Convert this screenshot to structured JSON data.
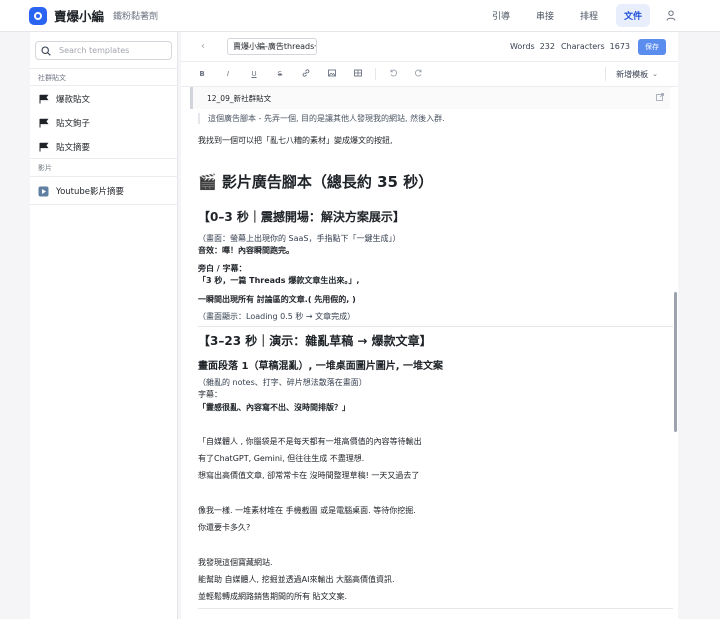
{
  "app": {
    "name": "賣爆小編",
    "subtitle": "鐵粉黏著劑"
  },
  "nav": {
    "items": [
      {
        "label": "引導"
      },
      {
        "label": "串接"
      },
      {
        "label": "排程"
      },
      {
        "label": "文件"
      }
    ],
    "active": "文件",
    "user_icon": "user-icon"
  },
  "sidebar": {
    "search_placeholder": "Search templates",
    "sections": [
      {
        "title": "社群貼文",
        "items": [
          {
            "label": "爆款貼文",
            "icon": "flag-icon"
          },
          {
            "label": "貼文鉤子",
            "icon": "flag-icon"
          },
          {
            "label": "貼文摘要",
            "icon": "flag-icon"
          }
        ]
      },
      {
        "title": "影片",
        "items": [
          {
            "label": "Youtube影片摘要",
            "icon": "play-icon"
          }
        ]
      }
    ]
  },
  "editor": {
    "doc_title": "賣爆小編-廣告threads一",
    "words_label": "Words",
    "words": "232",
    "chars_label": "Characters",
    "chars": "1673",
    "save_label": "保存",
    "toolbar": [
      "B",
      "I",
      "U",
      "S",
      "link",
      "image",
      "table",
      "undo",
      "redo"
    ],
    "template_menu": "新增模板",
    "note_label": "12_09_新社群貼文",
    "content": {
      "quote": "這個廣告腳本 - 先弄一個, 目的是讓其他人發現我的網站, 然後入群.",
      "p1": "我找到一個可以把「亂七八糟的素材」變成爆文的按鈕,",
      "h1": "🎬 影片廣告腳本（總長約 35 秒）",
      "h2_a": "【0–3 秒｜震撼開場：解決方案展示】",
      "a1": "（畫面：螢幕上出現你的 SaaS，手指點下「一鍵生成」）",
      "a2": "音效：嗶！內容瞬間跑完。",
      "a3": "旁白 / 字幕：",
      "a4": "「3 秒，一篇 Threads 爆款文章生出來。」,",
      "a5": "一瞬間出現所有 討論區的文章.( 先用假的, )",
      "a6": "（畫面顯示：Loading 0.5 秒 → 文章完成）",
      "h2_b": "【3–23 秒｜演示：雜亂草稿 → 爆款文章】",
      "h3_b": "畫面段落 1（草稿混亂）, 一堆桌面圖片圖片, 一堆文案",
      "b1": "（雜亂的 notes、打字、碎片想法散落在畫面）",
      "b2": "字幕：",
      "b3": "「靈感很亂、內容寫不出、沒時間排版？」",
      "c1": "「自媒體人 , 你腦袋是不是每天都有一堆高價值的內容等待輸出",
      "c2": "有了ChatGPT, Gemini, 但往往生成 不盡理想.",
      "c3": "想寫出高價值文章, 卻常常卡在 沒時間整理草稿! 一天又過去了",
      "d1": "像我一樣. 一堆素材堆在 手機截圖 或是電腦桌面. 等待你挖掘.",
      "d2": "你還要卡多久?",
      "e1": "我發現這個寶藏網站.",
      "e2": "能幫助 自媒體人, 挖掘並透過AI來輸出 大腦高價值資訊.",
      "e3": "並輕鬆轉成網路銷售期間的所有 貼文文案."
    }
  },
  "colors": {
    "brand": "#2a64f2",
    "save": "#5b8def",
    "active_tab_bg": "#e8eefc"
  }
}
